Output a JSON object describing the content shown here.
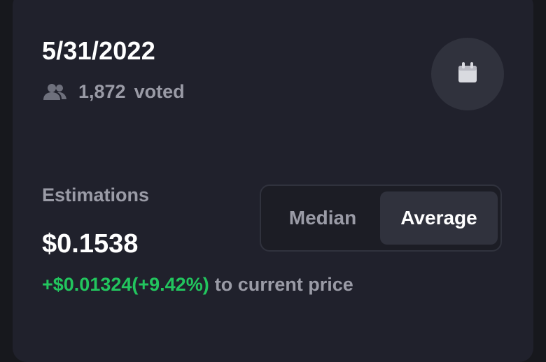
{
  "card": {
    "date": "5/31/2022",
    "voted_count": "1,872",
    "voted_label": "voted",
    "icons": {
      "users": "users-icon",
      "calendar": "calendar-icon"
    }
  },
  "estimation": {
    "label": "Estimations",
    "value": "$0.1538",
    "diff": "+$0.01324(+9.42%)",
    "diff_suffix": "to current price"
  },
  "toggle": {
    "options": [
      "Median",
      "Average"
    ],
    "selected": "Average"
  },
  "colors": {
    "card_bg": "#20212c",
    "positive": "#22c55e",
    "muted_text": "#9a9ba6",
    "selected_bg": "#30323d"
  }
}
